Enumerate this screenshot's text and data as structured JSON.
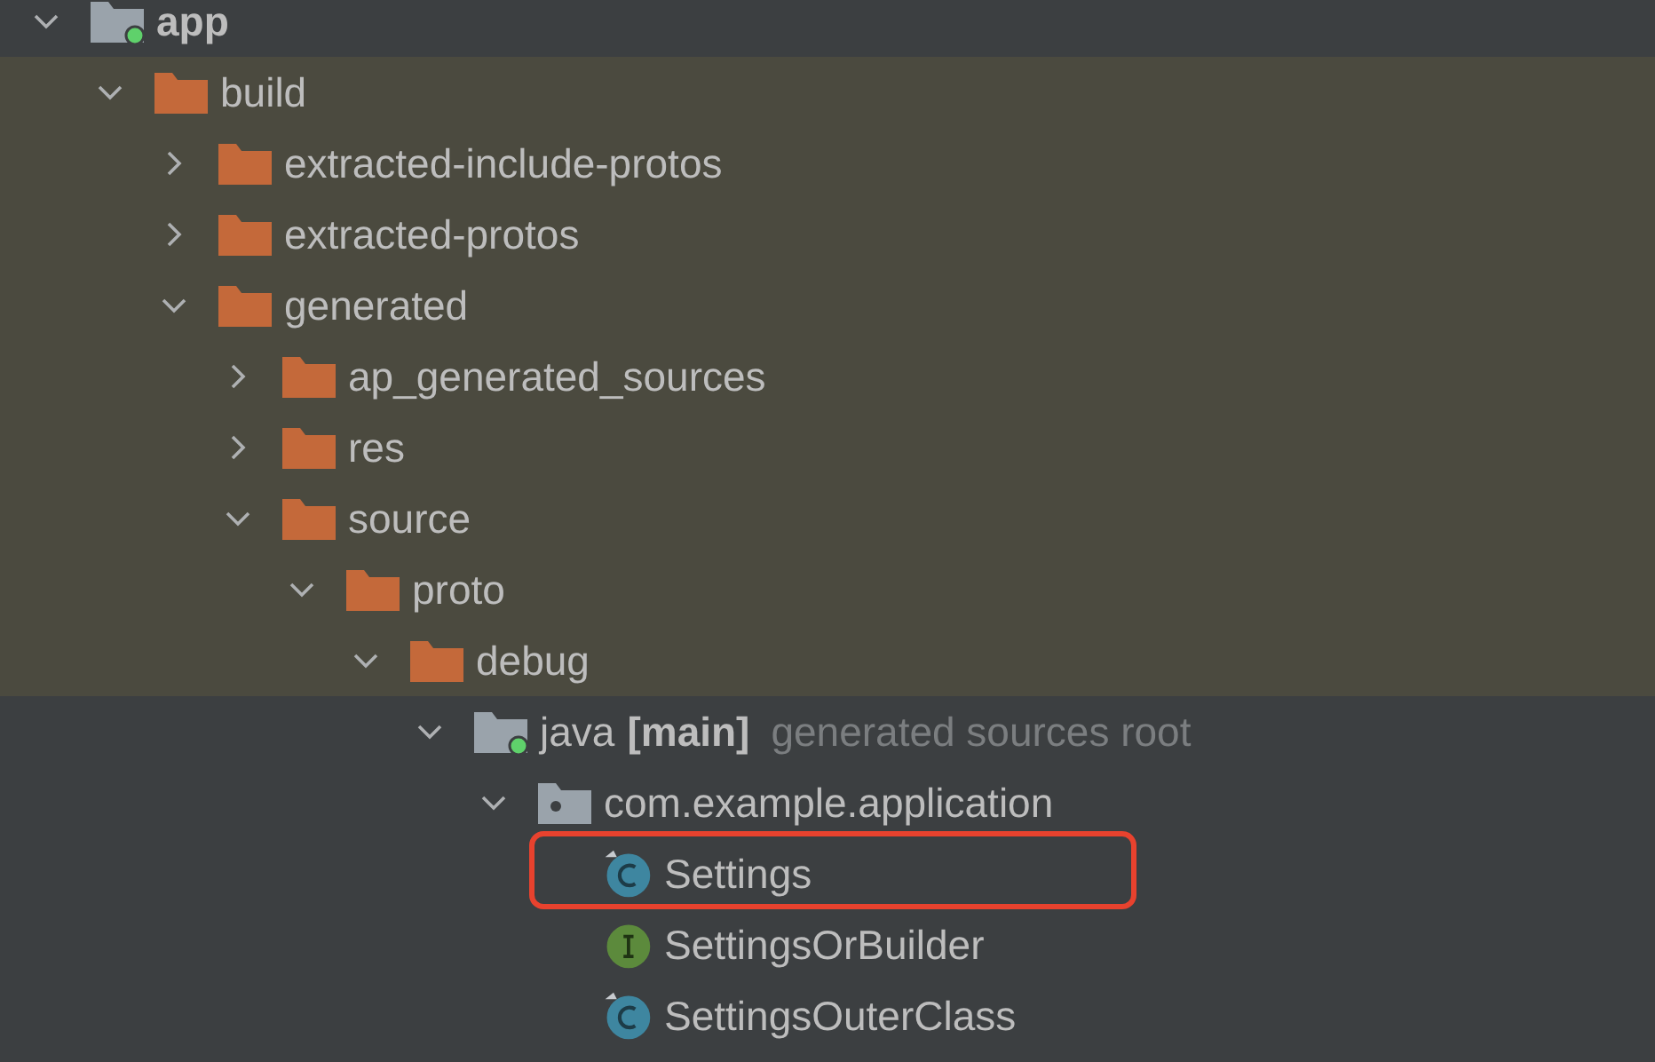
{
  "tree": [
    {
      "label": "app",
      "kind": "module",
      "expanded": true,
      "excluded": false,
      "children": [
        {
          "label": "build",
          "kind": "folder",
          "expanded": true,
          "excluded": true,
          "children": [
            {
              "label": "extracted-include-protos",
              "kind": "folder",
              "expanded": false,
              "excluded": true
            },
            {
              "label": "extracted-protos",
              "kind": "folder",
              "expanded": false,
              "excluded": true
            },
            {
              "label": "generated",
              "kind": "folder",
              "expanded": true,
              "excluded": true,
              "children": [
                {
                  "label": "ap_generated_sources",
                  "kind": "folder",
                  "expanded": false,
                  "excluded": true
                },
                {
                  "label": "res",
                  "kind": "folder",
                  "expanded": false,
                  "excluded": true
                },
                {
                  "label": "source",
                  "kind": "folder",
                  "expanded": true,
                  "excluded": true,
                  "children": [
                    {
                      "label": "proto",
                      "kind": "folder",
                      "expanded": true,
                      "excluded": true,
                      "children": [
                        {
                          "label": "debug",
                          "kind": "folder",
                          "expanded": true,
                          "excluded": true,
                          "children": [
                            {
                              "label": "java",
                              "tag": "[main]",
                              "hint": "generated sources root",
                              "kind": "module",
                              "expanded": true,
                              "excluded": false,
                              "children": [
                                {
                                  "label": "com.example.application",
                                  "kind": "package",
                                  "expanded": true,
                                  "excluded": false,
                                  "children": [
                                    {
                                      "label": "Settings",
                                      "kind": "class",
                                      "excluded": false,
                                      "marked": true
                                    },
                                    {
                                      "label": "SettingsOrBuilder",
                                      "kind": "interface",
                                      "excluded": false,
                                      "marked": false
                                    },
                                    {
                                      "label": "SettingsOuterClass",
                                      "kind": "class",
                                      "excluded": false,
                                      "marked": false
                                    }
                                  ]
                                }
                              ]
                            }
                          ]
                        }
                      ]
                    }
                  ]
                }
              ]
            }
          ]
        }
      ]
    }
  ]
}
